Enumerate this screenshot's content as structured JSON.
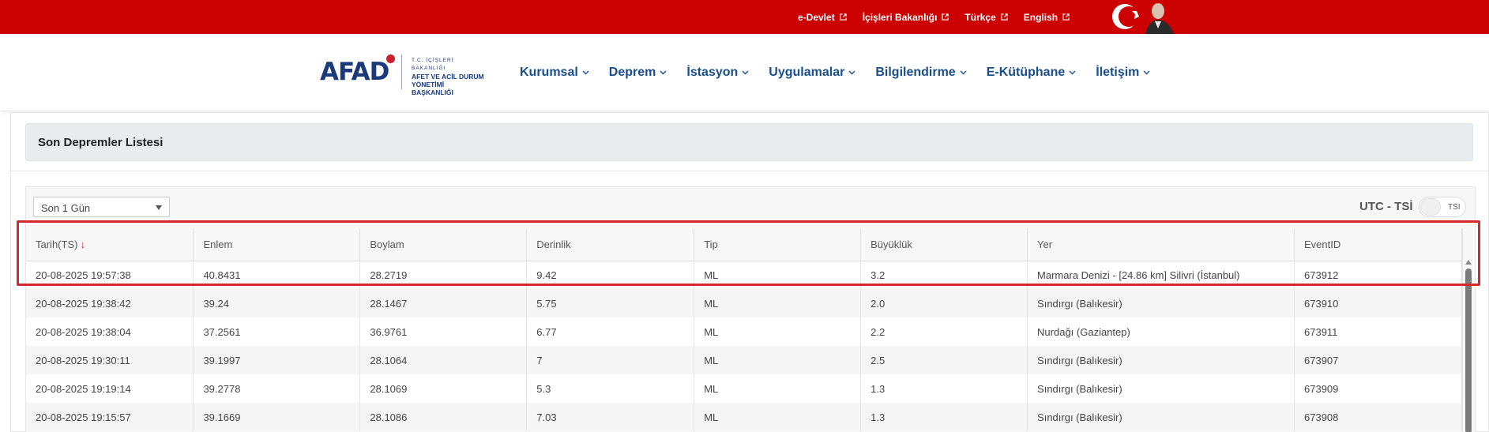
{
  "topbar": {
    "links": [
      "e-Devlet",
      "İçişleri Bakanlığı",
      "Türkçe",
      "English"
    ]
  },
  "logo": {
    "name": "AFAD",
    "line1": "T.C. İÇİŞLERİ BAKANLIĞI",
    "line2": "AFET VE ACİL DURUM",
    "line3": "YÖNETİMİ BAŞKANLIĞI"
  },
  "nav": {
    "items": [
      "Kurumsal",
      "Deprem",
      "İstasyon",
      "Uygulamalar",
      "Bilgilendirme",
      "E-Kütüphane",
      "İletişim"
    ]
  },
  "panel": {
    "title": "Son Depremler Listesi"
  },
  "filter": {
    "period": "Son 1 Gün"
  },
  "timezone": {
    "label": "UTC - TSİ",
    "toggle_state": "TSI"
  },
  "table": {
    "columns": [
      "Tarih(TS)",
      "Enlem",
      "Boylam",
      "Derinlik",
      "Tip",
      "Büyüklük",
      "Yer",
      "EventID"
    ],
    "rows": [
      [
        "20-08-2025 19:57:38",
        "40.8431",
        "28.2719",
        "9.42",
        "ML",
        "3.2",
        "Marmara Denizi - [24.86 km] Silivri (İstanbul)",
        "673912"
      ],
      [
        "20-08-2025 19:38:42",
        "39.24",
        "28.1467",
        "5.75",
        "ML",
        "2.0",
        "Sındırgı (Balıkesir)",
        "673910"
      ],
      [
        "20-08-2025 19:38:04",
        "37.2561",
        "36.9761",
        "6.77",
        "ML",
        "2.2",
        "Nurdağı (Gaziantep)",
        "673911"
      ],
      [
        "20-08-2025 19:30:11",
        "39.1997",
        "28.1064",
        "7",
        "ML",
        "2.5",
        "Sındırgı (Balıkesir)",
        "673907"
      ],
      [
        "20-08-2025 19:19:14",
        "39.2778",
        "28.1069",
        "5.3",
        "ML",
        "1.3",
        "Sındırgı (Balıkesir)",
        "673909"
      ],
      [
        "20-08-2025 19:15:57",
        "39.1669",
        "28.1086",
        "7.03",
        "ML",
        "1.3",
        "Sındırgı (Balıkesir)",
        "673908"
      ]
    ]
  },
  "colors": {
    "topbar": "#cc0000",
    "nav_text": "#1a4e8a",
    "highlight": "#d62630"
  }
}
